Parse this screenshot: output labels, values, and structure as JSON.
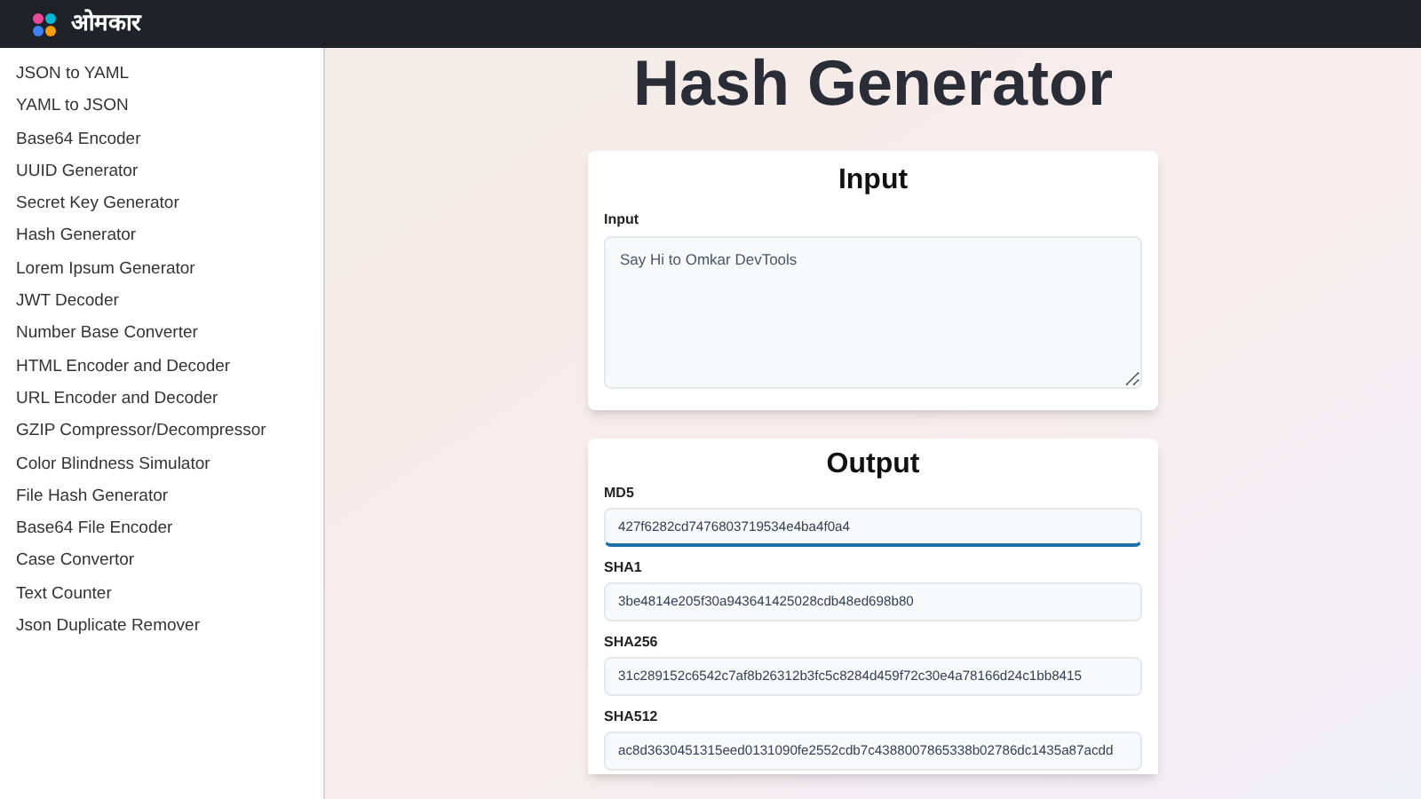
{
  "header": {
    "brand": "ओमकार"
  },
  "sidebar": {
    "items": [
      {
        "label": "JSON to YAML",
        "selected": false
      },
      {
        "label": "YAML to JSON",
        "selected": false
      },
      {
        "label": "Base64 Encoder",
        "selected": false
      },
      {
        "label": "UUID Generator",
        "selected": false
      },
      {
        "label": "Secret Key Generator",
        "selected": false
      },
      {
        "label": "Hash Generator",
        "selected": false
      },
      {
        "label": "Lorem Ipsum Generator",
        "selected": false
      },
      {
        "label": "JWT Decoder",
        "selected": false
      },
      {
        "label": "Number Base Converter",
        "selected": false
      },
      {
        "label": "HTML Encoder and Decoder",
        "selected": false
      },
      {
        "label": "URL Encoder and Decoder",
        "selected": false
      },
      {
        "label": "GZIP Compressor/Decompressor",
        "selected": false
      },
      {
        "label": "Color Blindness Simulator",
        "selected": false
      },
      {
        "label": "File Hash Generator",
        "selected": false
      },
      {
        "label": "Base64 File Encoder",
        "selected": false
      },
      {
        "label": "Case Convertor",
        "selected": false
      },
      {
        "label": "Text Counter",
        "selected": false
      },
      {
        "label": "Json Duplicate Remover",
        "selected": false
      }
    ]
  },
  "main": {
    "title": "Hash Generator",
    "input_card": {
      "title": "Input",
      "label": "Input",
      "value": "Say Hi to Omkar DevTools"
    },
    "output_card": {
      "title": "Output",
      "fields": [
        {
          "label": "MD5",
          "value": "427f6282cd7476803719534e4ba4f0a4",
          "focused": true
        },
        {
          "label": "SHA1",
          "value": "3be4814e205f30a943641425028cdb48ed698b80",
          "focused": false
        },
        {
          "label": "SHA256",
          "value": "31c289152c6542c7af8b26312b3fc5c8284d459f72c30e4a78166d24c1bb8415",
          "focused": false
        },
        {
          "label": "SHA512",
          "value": "ac8d3630451315eed0131090fe2552cdb7c4388007865338b02786dc1435a87acdd",
          "focused": false
        }
      ]
    }
  }
}
